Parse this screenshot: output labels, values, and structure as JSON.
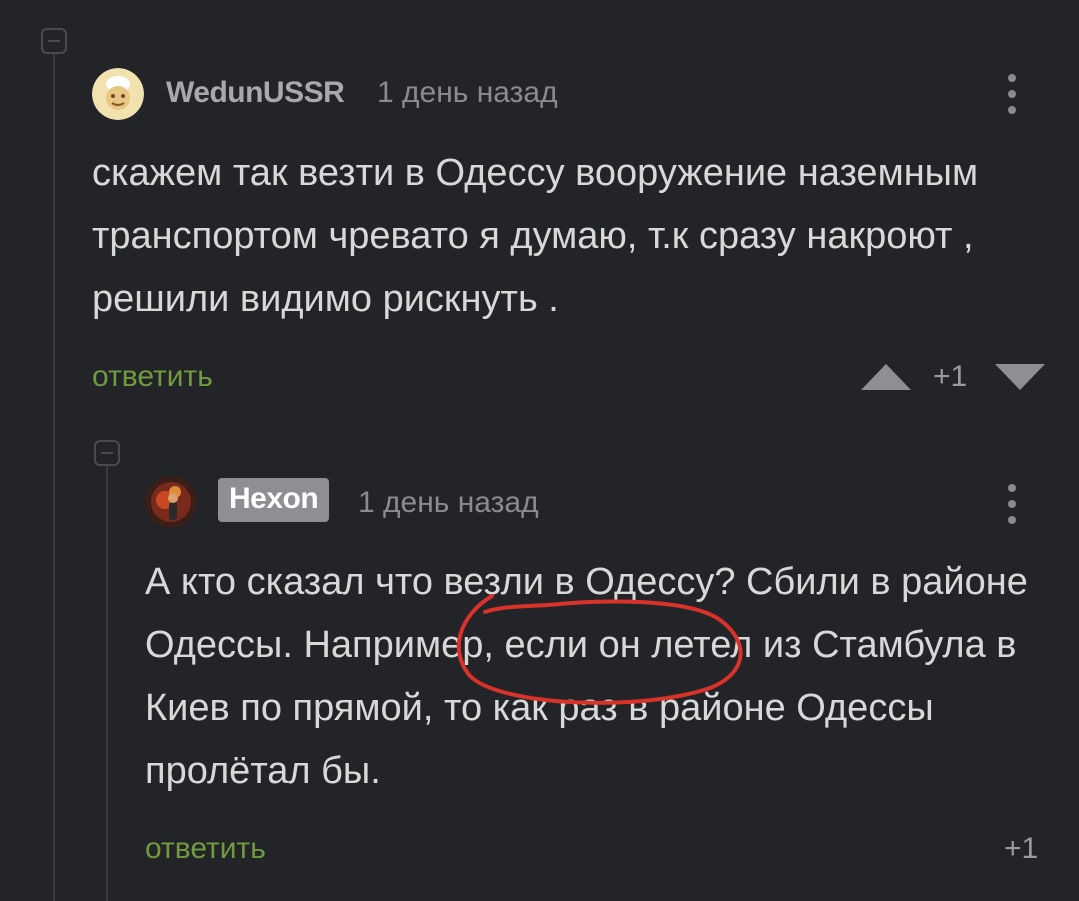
{
  "comments": [
    {
      "author": "WedunUSSR",
      "time": "1 день назад",
      "text": "скажем так везти в Одессу вооружение наземным транспортом чревато я думаю, т.к сразу накроют , решили видимо рискнуть .",
      "reply_label": "ответить",
      "score": "+1",
      "avatar_icon": "avatar-cartoon-icon"
    },
    {
      "author": "Hexon",
      "time": "1 день назад",
      "text": "А кто сказал что везли в Одессу? Сбили в районе Одессы. Например, если он летел из Стамбула в Киев по прямой, то как раз в районе Одессы пролётал бы.",
      "reply_label": "ответить",
      "score": "+1",
      "avatar_icon": "avatar-character-icon"
    }
  ],
  "colors": {
    "background": "#232428",
    "reply": "#6f9a3f",
    "annotation": "#d8322a"
  }
}
